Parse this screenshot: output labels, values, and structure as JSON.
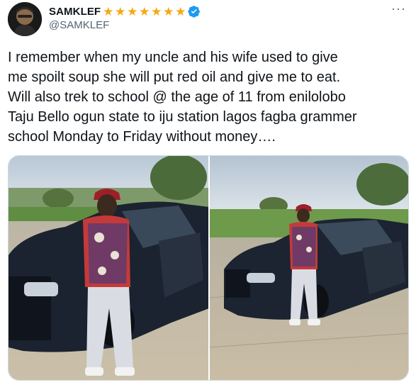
{
  "author": {
    "display_name": "SAMKLEF",
    "handle": "@SAMKLEF",
    "stars": [
      "★",
      "★",
      "★",
      "★",
      "★",
      "★",
      "★"
    ],
    "verified_icon": "verified-badge-icon"
  },
  "more_label": "···",
  "tweet": {
    "lines": [
      "I remember when my uncle and his wife used to give",
      "me spoilt soup she will put red oil and give me to eat.",
      "Will also trek to school @ the age of 11 from enilolobo",
      "Taju Bello ogun state to iju station lagos fagba grammer",
      "school Monday to Friday without money…."
    ]
  },
  "media": {
    "photos": [
      "photo-1",
      "photo-2"
    ]
  },
  "colors": {
    "text": "#0f1419",
    "secondary": "#536471",
    "star": "#f3a912",
    "verified": "#1d9bf0",
    "border": "#cfd9de"
  }
}
